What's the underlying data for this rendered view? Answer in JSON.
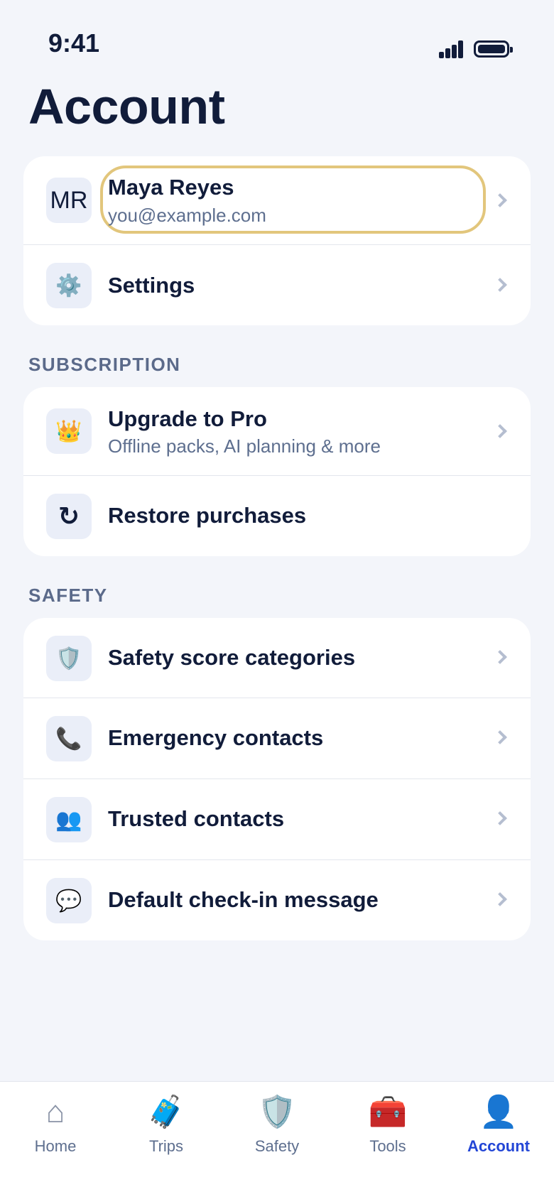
{
  "status_bar": {
    "time": "9:41"
  },
  "page_title": "Account",
  "profile": {
    "initials": "MR",
    "name": "Maya Reyes",
    "email": "you@example.com"
  },
  "account_rows": [
    {
      "label": "Settings",
      "icon": "gear-icon",
      "glyph": "⚙️"
    }
  ],
  "subscription": {
    "section_label": "SUBSCRIPTION",
    "upgrade": {
      "label": "Upgrade to Pro",
      "sub": "Offline packs, AI planning & more",
      "icon": "crown-icon",
      "glyph": "👑"
    },
    "restore": {
      "label": "Restore purchases",
      "icon": "refresh-icon",
      "glyph": "↻"
    }
  },
  "safety": {
    "section_label": "SAFETY",
    "items": [
      {
        "label": "Safety score categories",
        "icon": "shield-icon",
        "glyph": "🛡️"
      },
      {
        "label": "Emergency contacts",
        "icon": "phone-icon",
        "glyph": "📞"
      },
      {
        "label": "Trusted contacts",
        "icon": "people-icon",
        "glyph": "👥"
      },
      {
        "label": "Default check-in message",
        "icon": "speech-bubble-icon",
        "glyph": "💬"
      }
    ]
  },
  "tabs": [
    {
      "label": "Home",
      "icon": "home-icon",
      "glyph": "⌂"
    },
    {
      "label": "Trips",
      "icon": "luggage-icon",
      "glyph": "🧳"
    },
    {
      "label": "Safety",
      "icon": "shield-icon",
      "glyph": "🛡️"
    },
    {
      "label": "Tools",
      "icon": "toolbox-icon",
      "glyph": "🧰"
    },
    {
      "label": "Account",
      "icon": "person-icon",
      "glyph": "👤"
    }
  ],
  "colors": {
    "accent": "#2346d6",
    "highlight": "#e2c67c",
    "background": "#f3f5fa"
  }
}
